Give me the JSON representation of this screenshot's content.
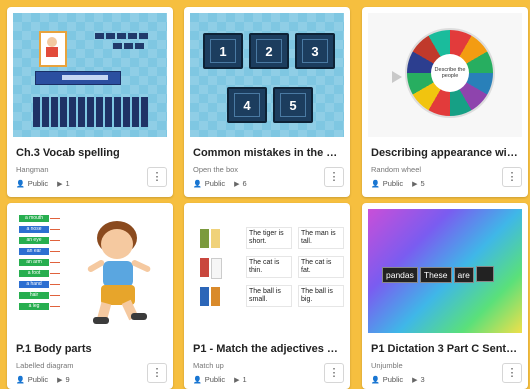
{
  "colors": {
    "page_bg": "#f6bf3f",
    "card_bg": "#ffffff",
    "accent_green": "#27ae4f",
    "accent_blue": "#2d6fd1"
  },
  "cards": [
    {
      "title": "Ch.3 Vocab spelling",
      "type": "Hangman",
      "visibility": "Public",
      "plays": "1",
      "menu_icon": "⋮"
    },
    {
      "title": "Common mistakes in the an...",
      "type": "Open the box",
      "visibility": "Public",
      "plays": "6",
      "menu_icon": "⋮",
      "boxes": [
        "1",
        "2",
        "3",
        "4",
        "5"
      ]
    },
    {
      "title": "Describing appearance with...",
      "type": "Random wheel",
      "visibility": "Public",
      "plays": "5",
      "menu_icon": "⋮",
      "wheel_center": "Describe the people"
    },
    {
      "title": "P.1 Body parts",
      "type": "Labelled diagram",
      "visibility": "Public",
      "plays": "9",
      "menu_icon": "⋮",
      "labels": [
        "a mouth",
        "a nose",
        "an eye",
        "an ear",
        "an arm",
        "a foot",
        "a hand",
        "hair",
        "a leg"
      ]
    },
    {
      "title": "P1 - Match the adjectives an...",
      "type": "Match up",
      "visibility": "Public",
      "plays": "1",
      "menu_icon": "⋮",
      "sentences": [
        [
          "The tiger is short.",
          "The man is tall."
        ],
        [
          "The cat is thin.",
          "The cat is fat."
        ],
        [
          "The ball is small.",
          "The ball is big."
        ]
      ]
    },
    {
      "title": "P1 Dictation 3 Part C Senten...",
      "type": "Unjumble",
      "visibility": "Public",
      "plays": "3",
      "menu_icon": "⋮",
      "words": [
        "pandas",
        "These",
        "are",
        ""
      ]
    }
  ]
}
